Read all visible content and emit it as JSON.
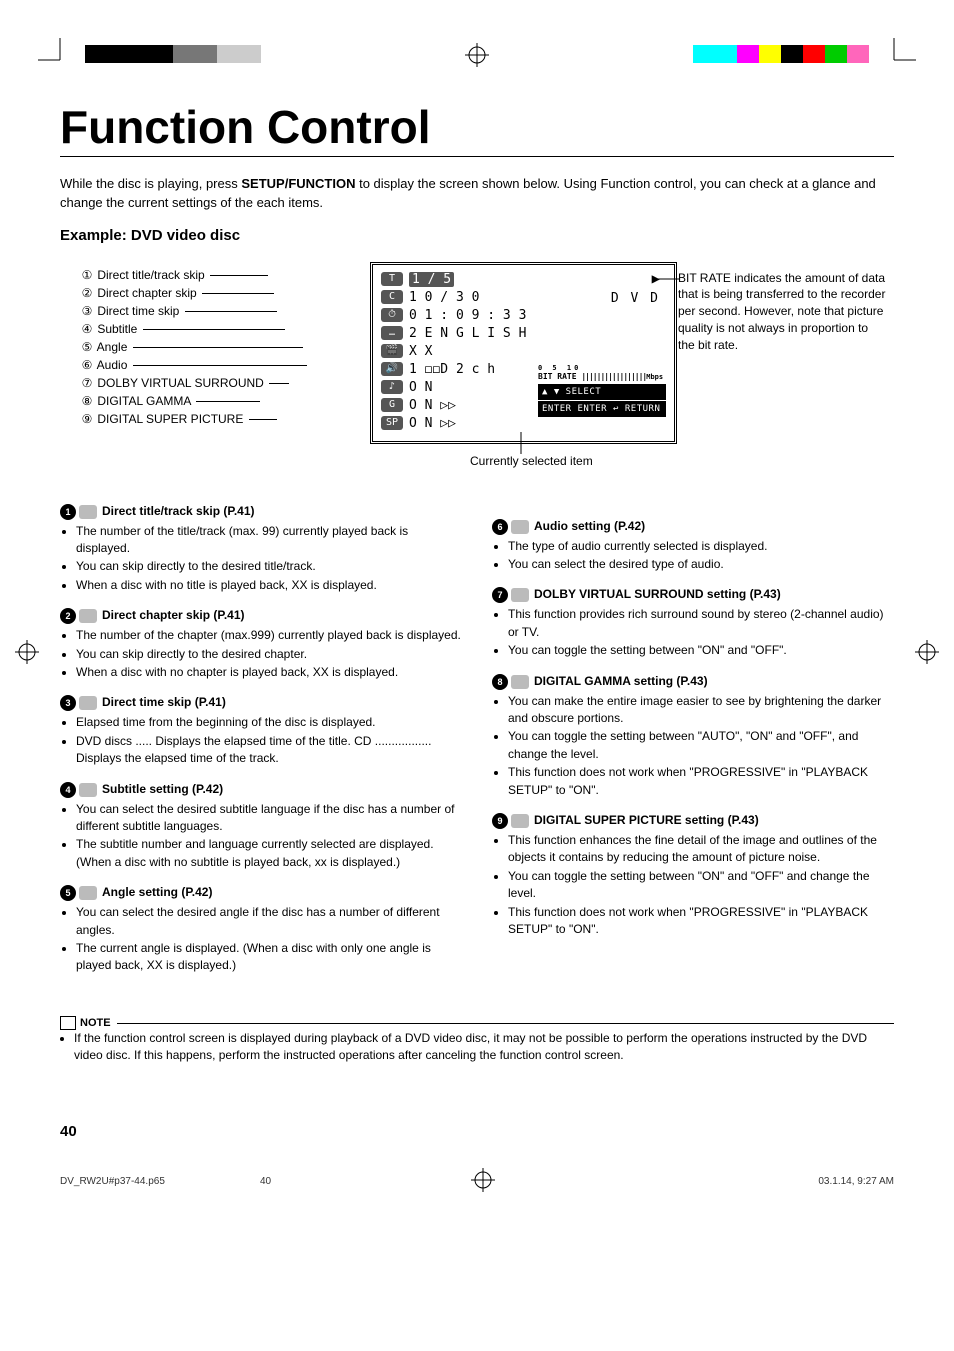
{
  "page": {
    "title": "Function Control",
    "intro_before": "While the disc is playing, press ",
    "intro_bold": "SETUP/FUNCTION",
    "intro_after": " to display the screen shown below. Using Function control, you can check at a glance and change the current settings of the each items.",
    "example_heading": "Example: DVD video disc",
    "page_number": "40",
    "footer_file": "DV_RW2U#p37-44.p65",
    "footer_page": "40",
    "footer_date": "03.1.14, 9:27 AM"
  },
  "diagram_labels": [
    {
      "num": "1",
      "text": "Direct title/track skip"
    },
    {
      "num": "2",
      "text": "Direct chapter skip"
    },
    {
      "num": "3",
      "text": "Direct time skip"
    },
    {
      "num": "4",
      "text": "Subtitle"
    },
    {
      "num": "5",
      "text": "Angle"
    },
    {
      "num": "6",
      "text": "Audio"
    },
    {
      "num": "7",
      "text": "DOLBY VIRTUAL SURROUND"
    },
    {
      "num": "8",
      "text": "DIGITAL GAMMA"
    },
    {
      "num": "9",
      "text": "DIGITAL SUPER PICTURE"
    }
  ],
  "osd": {
    "rows": [
      {
        "icon": "T",
        "val": "1 / 5"
      },
      {
        "icon": "C",
        "val": "1 0 / 3 0"
      },
      {
        "icon": "⏱",
        "val": "0 1 : 0 9 : 3 3"
      },
      {
        "icon": "…",
        "val": "2  E N G L I S H"
      },
      {
        "icon": "🎬",
        "val": "X X"
      },
      {
        "icon": "🔊",
        "val": "1  ◻◻D   2 c h"
      },
      {
        "icon": "♪",
        "val": "O N"
      },
      {
        "icon": "G",
        "val": "O N     ▷▷"
      },
      {
        "icon": "SP",
        "val": "O N     ▷▷"
      }
    ],
    "play_glyph": "▶",
    "dvd": "D V D",
    "bitrate_label": "BIT RATE",
    "bitrate_scale": "0      5     10",
    "bitrate_unit": "Mbps",
    "select": "▲ ▼ SELECT",
    "enter_line": "ENTER ENTER ↩ RETURN"
  },
  "bitrate_note": "BIT RATE indicates the amount of data that is being transferred to the recorder per second. However, note that picture quality is not always in proportion to the bit rate.",
  "currently_selected": "Currently selected item",
  "sections_left": [
    {
      "num": "1",
      "title": "Direct title/track skip (P.41)",
      "bullets": [
        "The number of the title/track (max. 99) currently played back is displayed.",
        "You can skip directly to the desired title/track.",
        "When a disc with no title is played back, XX is displayed."
      ]
    },
    {
      "num": "2",
      "title": "Direct chapter skip (P.41)",
      "bullets": [
        "The number of the chapter (max.999) currently played back is displayed.",
        "You can skip directly to the desired chapter.",
        "When a disc with no chapter is played back, XX is displayed."
      ]
    },
    {
      "num": "3",
      "title": "Direct time skip (P.41)",
      "bullets": [
        "Elapsed time from the beginning of the disc is displayed.",
        "DVD discs ..... Displays the elapsed time of the title. CD ................. Displays the elapsed time of the track."
      ]
    },
    {
      "num": "4",
      "title": "Subtitle setting (P.42)",
      "bullets": [
        "You can select the desired subtitle language if the disc has a number of different subtitle languages.",
        "The subtitle number and language currently selected are displayed. (When a disc with no subtitle is played back, xx is displayed.)"
      ]
    },
    {
      "num": "5",
      "title": "Angle setting (P.42)",
      "bullets": [
        "You can select the desired angle if the disc has a number of different angles.",
        "The current angle is displayed. (When a disc with only one angle is played back, XX is displayed.)"
      ]
    }
  ],
  "sections_right": [
    {
      "num": "6",
      "title": "Audio setting (P.42)",
      "bullets": [
        "The type of audio currently selected is displayed.",
        "You can select the desired type of audio."
      ]
    },
    {
      "num": "7",
      "title": "DOLBY VIRTUAL SURROUND setting (P.43)",
      "bullets": [
        "This function provides rich surround sound by stereo (2-channel audio) or TV.",
        "You can toggle the setting between \"ON\" and \"OFF\"."
      ]
    },
    {
      "num": "8",
      "title": "DIGITAL GAMMA setting (P.43)",
      "bullets": [
        "You can make the entire image easier to see by brightening the darker and obscure portions.",
        "You can toggle the setting between \"AUTO\", \"ON\" and \"OFF\", and change the level.",
        "This function does not work when \"PROGRESSIVE\" in \"PLAYBACK SETUP\" to \"ON\"."
      ]
    },
    {
      "num": "9",
      "title": "DIGITAL SUPER PICTURE setting (P.43)",
      "bullets": [
        "This function enhances the fine detail of the image and outlines of the objects it contains by reducing the amount of picture noise.",
        "You can toggle the setting between \"ON\" and \"OFF\" and change the level.",
        "This function does not work when \"PROGRESSIVE\" in \"PLAYBACK SETUP\" to \"ON\"."
      ]
    }
  ],
  "note": {
    "heading": "NOTE",
    "bullets": [
      "If the function control screen is displayed during playback of a DVD video disc, it may not be possible to perform the operations instructed by the DVD video disc.  If this happens, perform the instructed operations after canceling the function control screen."
    ]
  }
}
